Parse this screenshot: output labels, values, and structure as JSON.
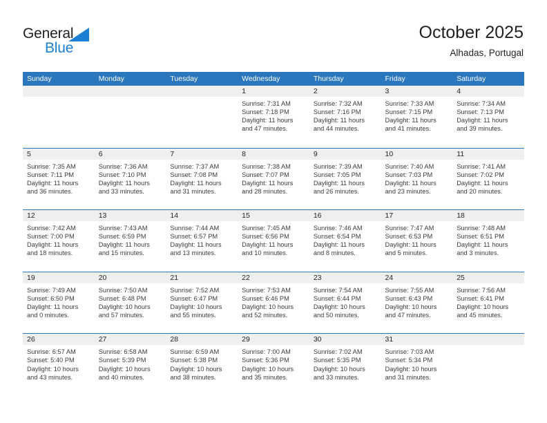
{
  "brand": {
    "name_top": "General",
    "name_bottom": "Blue",
    "top_color": "#231f20",
    "bottom_color": "#1b7fd4",
    "triangle_color": "#1b7fd4"
  },
  "header": {
    "title": "October 2025",
    "subtitle": "Alhadas, Portugal"
  },
  "colors": {
    "header_row_bg": "#2b77bd",
    "header_row_text": "#ffffff",
    "day_strip_bg": "#efefef",
    "row_divider": "#2b77bd",
    "body_text": "#3b3b3b"
  },
  "weekdays": [
    "Sunday",
    "Monday",
    "Tuesday",
    "Wednesday",
    "Thursday",
    "Friday",
    "Saturday"
  ],
  "weeks": [
    [
      {
        "empty": true
      },
      {
        "empty": true
      },
      {
        "empty": true
      },
      {
        "day": "1",
        "sunrise": "Sunrise: 7:31 AM",
        "sunset": "Sunset: 7:18 PM",
        "daylight_line1": "Daylight: 11 hours",
        "daylight_line2": "and 47 minutes."
      },
      {
        "day": "2",
        "sunrise": "Sunrise: 7:32 AM",
        "sunset": "Sunset: 7:16 PM",
        "daylight_line1": "Daylight: 11 hours",
        "daylight_line2": "and 44 minutes."
      },
      {
        "day": "3",
        "sunrise": "Sunrise: 7:33 AM",
        "sunset": "Sunset: 7:15 PM",
        "daylight_line1": "Daylight: 11 hours",
        "daylight_line2": "and 41 minutes."
      },
      {
        "day": "4",
        "sunrise": "Sunrise: 7:34 AM",
        "sunset": "Sunset: 7:13 PM",
        "daylight_line1": "Daylight: 11 hours",
        "daylight_line2": "and 39 minutes."
      }
    ],
    [
      {
        "day": "5",
        "sunrise": "Sunrise: 7:35 AM",
        "sunset": "Sunset: 7:11 PM",
        "daylight_line1": "Daylight: 11 hours",
        "daylight_line2": "and 36 minutes."
      },
      {
        "day": "6",
        "sunrise": "Sunrise: 7:36 AM",
        "sunset": "Sunset: 7:10 PM",
        "daylight_line1": "Daylight: 11 hours",
        "daylight_line2": "and 33 minutes."
      },
      {
        "day": "7",
        "sunrise": "Sunrise: 7:37 AM",
        "sunset": "Sunset: 7:08 PM",
        "daylight_line1": "Daylight: 11 hours",
        "daylight_line2": "and 31 minutes."
      },
      {
        "day": "8",
        "sunrise": "Sunrise: 7:38 AM",
        "sunset": "Sunset: 7:07 PM",
        "daylight_line1": "Daylight: 11 hours",
        "daylight_line2": "and 28 minutes."
      },
      {
        "day": "9",
        "sunrise": "Sunrise: 7:39 AM",
        "sunset": "Sunset: 7:05 PM",
        "daylight_line1": "Daylight: 11 hours",
        "daylight_line2": "and 26 minutes."
      },
      {
        "day": "10",
        "sunrise": "Sunrise: 7:40 AM",
        "sunset": "Sunset: 7:03 PM",
        "daylight_line1": "Daylight: 11 hours",
        "daylight_line2": "and 23 minutes."
      },
      {
        "day": "11",
        "sunrise": "Sunrise: 7:41 AM",
        "sunset": "Sunset: 7:02 PM",
        "daylight_line1": "Daylight: 11 hours",
        "daylight_line2": "and 20 minutes."
      }
    ],
    [
      {
        "day": "12",
        "sunrise": "Sunrise: 7:42 AM",
        "sunset": "Sunset: 7:00 PM",
        "daylight_line1": "Daylight: 11 hours",
        "daylight_line2": "and 18 minutes."
      },
      {
        "day": "13",
        "sunrise": "Sunrise: 7:43 AM",
        "sunset": "Sunset: 6:59 PM",
        "daylight_line1": "Daylight: 11 hours",
        "daylight_line2": "and 15 minutes."
      },
      {
        "day": "14",
        "sunrise": "Sunrise: 7:44 AM",
        "sunset": "Sunset: 6:57 PM",
        "daylight_line1": "Daylight: 11 hours",
        "daylight_line2": "and 13 minutes."
      },
      {
        "day": "15",
        "sunrise": "Sunrise: 7:45 AM",
        "sunset": "Sunset: 6:56 PM",
        "daylight_line1": "Daylight: 11 hours",
        "daylight_line2": "and 10 minutes."
      },
      {
        "day": "16",
        "sunrise": "Sunrise: 7:46 AM",
        "sunset": "Sunset: 6:54 PM",
        "daylight_line1": "Daylight: 11 hours",
        "daylight_line2": "and 8 minutes."
      },
      {
        "day": "17",
        "sunrise": "Sunrise: 7:47 AM",
        "sunset": "Sunset: 6:53 PM",
        "daylight_line1": "Daylight: 11 hours",
        "daylight_line2": "and 5 minutes."
      },
      {
        "day": "18",
        "sunrise": "Sunrise: 7:48 AM",
        "sunset": "Sunset: 6:51 PM",
        "daylight_line1": "Daylight: 11 hours",
        "daylight_line2": "and 3 minutes."
      }
    ],
    [
      {
        "day": "19",
        "sunrise": "Sunrise: 7:49 AM",
        "sunset": "Sunset: 6:50 PM",
        "daylight_line1": "Daylight: 11 hours",
        "daylight_line2": "and 0 minutes."
      },
      {
        "day": "20",
        "sunrise": "Sunrise: 7:50 AM",
        "sunset": "Sunset: 6:48 PM",
        "daylight_line1": "Daylight: 10 hours",
        "daylight_line2": "and 57 minutes."
      },
      {
        "day": "21",
        "sunrise": "Sunrise: 7:52 AM",
        "sunset": "Sunset: 6:47 PM",
        "daylight_line1": "Daylight: 10 hours",
        "daylight_line2": "and 55 minutes."
      },
      {
        "day": "22",
        "sunrise": "Sunrise: 7:53 AM",
        "sunset": "Sunset: 6:46 PM",
        "daylight_line1": "Daylight: 10 hours",
        "daylight_line2": "and 52 minutes."
      },
      {
        "day": "23",
        "sunrise": "Sunrise: 7:54 AM",
        "sunset": "Sunset: 6:44 PM",
        "daylight_line1": "Daylight: 10 hours",
        "daylight_line2": "and 50 minutes."
      },
      {
        "day": "24",
        "sunrise": "Sunrise: 7:55 AM",
        "sunset": "Sunset: 6:43 PM",
        "daylight_line1": "Daylight: 10 hours",
        "daylight_line2": "and 47 minutes."
      },
      {
        "day": "25",
        "sunrise": "Sunrise: 7:56 AM",
        "sunset": "Sunset: 6:41 PM",
        "daylight_line1": "Daylight: 10 hours",
        "daylight_line2": "and 45 minutes."
      }
    ],
    [
      {
        "day": "26",
        "sunrise": "Sunrise: 6:57 AM",
        "sunset": "Sunset: 5:40 PM",
        "daylight_line1": "Daylight: 10 hours",
        "daylight_line2": "and 43 minutes."
      },
      {
        "day": "27",
        "sunrise": "Sunrise: 6:58 AM",
        "sunset": "Sunset: 5:39 PM",
        "daylight_line1": "Daylight: 10 hours",
        "daylight_line2": "and 40 minutes."
      },
      {
        "day": "28",
        "sunrise": "Sunrise: 6:59 AM",
        "sunset": "Sunset: 5:38 PM",
        "daylight_line1": "Daylight: 10 hours",
        "daylight_line2": "and 38 minutes."
      },
      {
        "day": "29",
        "sunrise": "Sunrise: 7:00 AM",
        "sunset": "Sunset: 5:36 PM",
        "daylight_line1": "Daylight: 10 hours",
        "daylight_line2": "and 35 minutes."
      },
      {
        "day": "30",
        "sunrise": "Sunrise: 7:02 AM",
        "sunset": "Sunset: 5:35 PM",
        "daylight_line1": "Daylight: 10 hours",
        "daylight_line2": "and 33 minutes."
      },
      {
        "day": "31",
        "sunrise": "Sunrise: 7:03 AM",
        "sunset": "Sunset: 5:34 PM",
        "daylight_line1": "Daylight: 10 hours",
        "daylight_line2": "and 31 minutes."
      },
      {
        "empty": true
      }
    ]
  ]
}
